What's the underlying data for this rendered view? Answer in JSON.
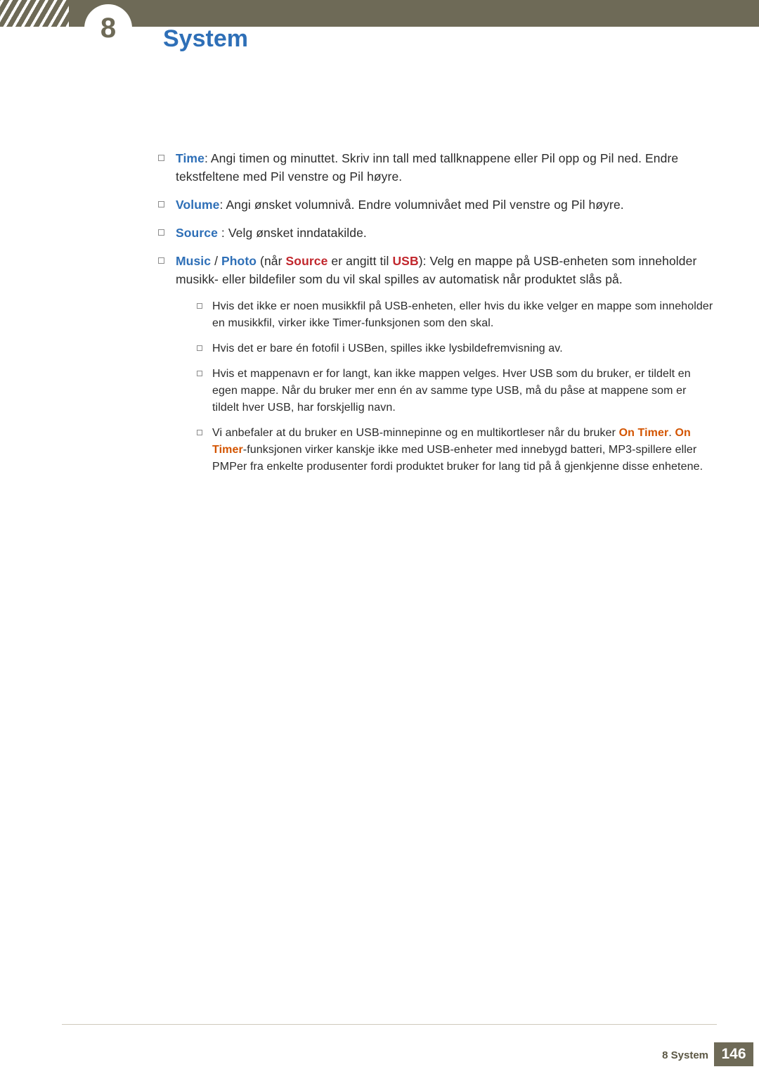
{
  "header": {
    "chapter_number": "8",
    "title": "System"
  },
  "content": {
    "items": [
      {
        "level": 1,
        "segments": [
          {
            "text": "Time",
            "style": "blue-bold"
          },
          {
            "text": ": Angi timen og minuttet. Skriv inn tall med tallknappene eller Pil opp og Pil ned. Endre tekstfeltene med Pil venstre og Pil høyre.",
            "style": "plain"
          }
        ]
      },
      {
        "level": 1,
        "segments": [
          {
            "text": "Volume",
            "style": "blue-bold"
          },
          {
            "text": ": Angi ønsket volumnivå. Endre volumnivået med Pil venstre og Pil høyre.",
            "style": "plain"
          }
        ]
      },
      {
        "level": 1,
        "segments": [
          {
            "text": "Source",
            "style": "blue-bold"
          },
          {
            "text": " : Velg ønsket inndatakilde.",
            "style": "plain"
          }
        ]
      },
      {
        "level": 1,
        "segments": [
          {
            "text": "Music",
            "style": "blue-bold"
          },
          {
            "text": " / ",
            "style": "plain"
          },
          {
            "text": "Photo",
            "style": "blue-bold"
          },
          {
            "text": " (når ",
            "style": "plain"
          },
          {
            "text": "Source",
            "style": "red-bold"
          },
          {
            "text": " er angitt til ",
            "style": "plain"
          },
          {
            "text": "USB",
            "style": "red-bold"
          },
          {
            "text": "): Velg en mappe på USB-enheten som inneholder musikk- eller bildefiler som du vil skal spilles av automatisk når produktet slås på.",
            "style": "plain"
          }
        ]
      },
      {
        "level": 2,
        "segments": [
          {
            "text": "Hvis det ikke er noen musikkfil på USB-enheten, eller hvis du ikke velger en mappe som inneholder en musikkfil, virker ikke Timer-funksjonen som den skal.",
            "style": "plain"
          }
        ]
      },
      {
        "level": 2,
        "segments": [
          {
            "text": "Hvis det er bare én fotofil i USBen, spilles ikke lysbildefremvisning av.",
            "style": "plain"
          }
        ]
      },
      {
        "level": 2,
        "segments": [
          {
            "text": "Hvis et mappenavn er for langt, kan ikke mappen velges. Hver USB som du bruker, er tildelt en egen mappe. Når du bruker mer enn én av samme type USB, må du påse at mappene som er tildelt hver USB, har forskjellig navn.",
            "style": "plain"
          }
        ]
      },
      {
        "level": 2,
        "segments": [
          {
            "text": "Vi anbefaler at du bruker en USB-minnepinne og en multikortleser når du bruker ",
            "style": "plain"
          },
          {
            "text": "On Timer",
            "style": "orange-bold"
          },
          {
            "text": ". ",
            "style": "plain"
          },
          {
            "text": "On Timer",
            "style": "orange-bold"
          },
          {
            "text": "-funksjonen virker kanskje ikke med USB-enheter med innebygd batteri, MP3-spillere eller PMPer fra enkelte produsenter fordi produktet bruker for lang tid på å gjenkjenne disse enhetene.",
            "style": "plain"
          }
        ]
      }
    ]
  },
  "footer": {
    "label": "8 System",
    "page_number": "146"
  },
  "colors": {
    "band": "#6e6a57",
    "heading_blue": "#2e6fb7",
    "accent_red": "#c1272d",
    "accent_orange": "#d35400"
  }
}
